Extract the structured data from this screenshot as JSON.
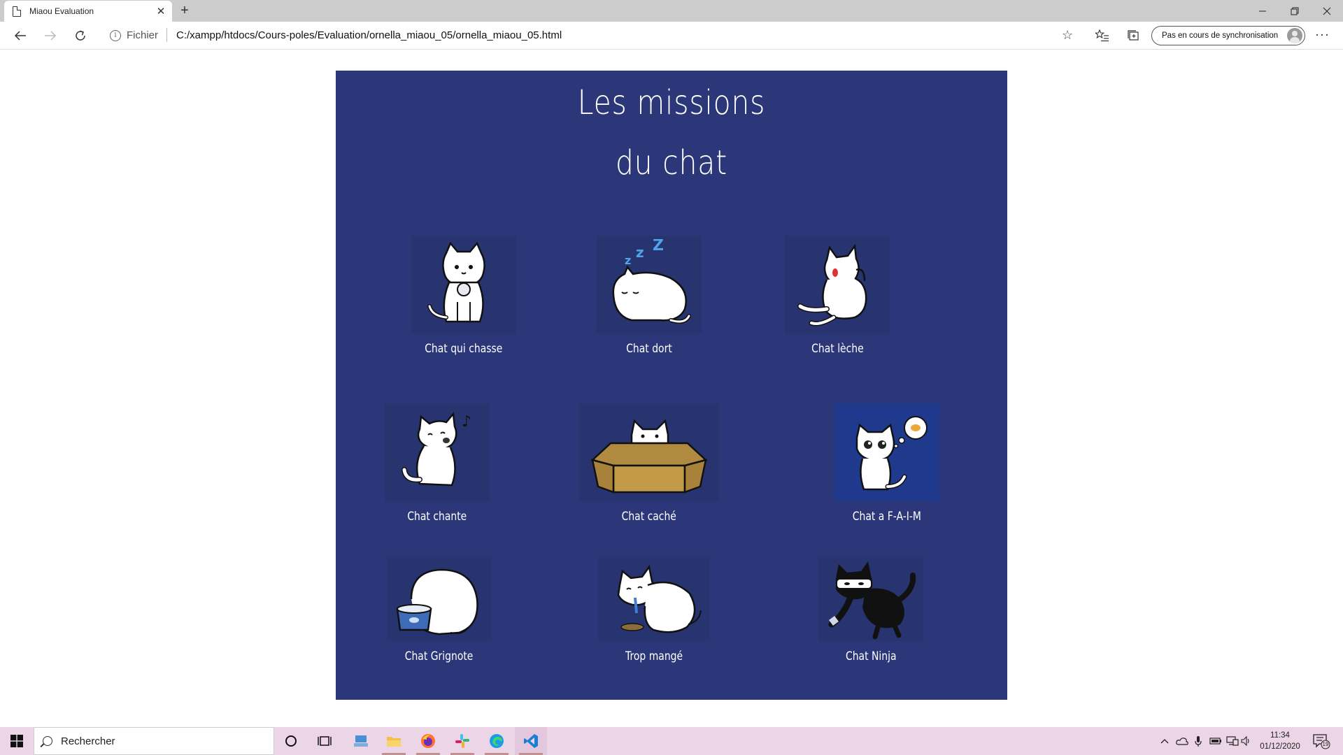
{
  "browser": {
    "tab_title": "Miaou Evaluation",
    "url_scheme_label": "Fichier",
    "url": "C:/xampp/htdocs/Cours-poles/Evaluation/ornella_miaou_05/ornella_miaou_05.html",
    "sync_label": "Pas en cours de synchronisation"
  },
  "page": {
    "title_line1": "Les missions",
    "title_line2": "du chat",
    "cats": [
      {
        "label": "Chat qui chasse",
        "icon": "cat-hunting-icon"
      },
      {
        "label": "Chat dort",
        "icon": "cat-sleeping-icon"
      },
      {
        "label": "Chat lèche",
        "icon": "cat-licking-icon"
      },
      {
        "label": "Chat chante",
        "icon": "cat-singing-icon"
      },
      {
        "label": "Chat caché",
        "icon": "cat-in-box-icon"
      },
      {
        "label": "Chat a F-A-I-M",
        "icon": "cat-hungry-icon"
      },
      {
        "label": "Chat Grignote",
        "icon": "cat-eating-bowl-icon"
      },
      {
        "label": "Trop mangé",
        "icon": "cat-vomiting-icon"
      },
      {
        "label": "Chat Ninja",
        "icon": "cat-ninja-icon"
      }
    ]
  },
  "taskbar": {
    "search_placeholder": "Rechercher",
    "time": "11:34",
    "date": "01/12/2020",
    "notification_count": "19"
  },
  "colors": {
    "panel_bg": "#2b3778",
    "taskbar_bg": "#ecd5e6",
    "tab_strip": "#cccccc"
  }
}
